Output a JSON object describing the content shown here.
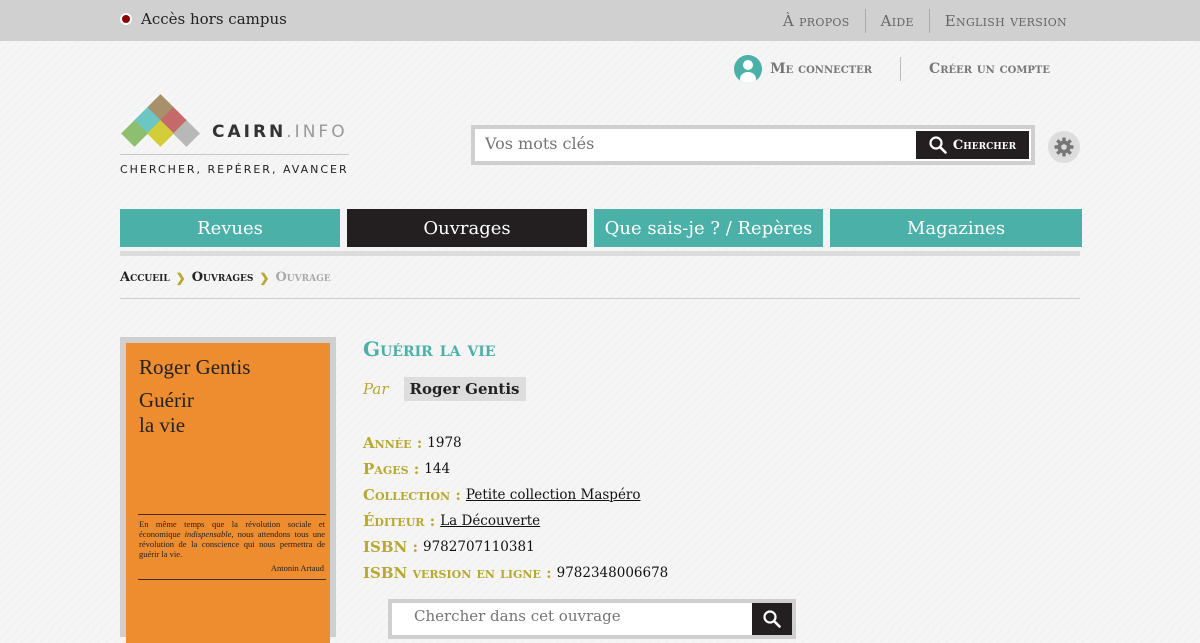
{
  "topbar": {
    "campus_label": "Accès hors campus",
    "links": [
      "À propos",
      "Aide",
      "English version"
    ]
  },
  "account": {
    "login": "Me connecter",
    "signup": "Créer un compte"
  },
  "logo": {
    "word": "CAIRN",
    "suffix": ".INFO",
    "tagline": "CHERCHER, REPÉRER, AVANCER",
    "colors": [
      "#a8906a",
      "#6cc6c2",
      "#c46a6a",
      "#8dbf6e",
      "#d4cd3a",
      "#b8b8b8"
    ]
  },
  "search": {
    "placeholder": "Vos mots clés",
    "button": "Chercher",
    "settings_icon": "gear-icon"
  },
  "nav": {
    "tabs": [
      {
        "label": "Revues",
        "active": false
      },
      {
        "label": "Ouvrages",
        "active": true
      },
      {
        "label": "Que sais-je ? / Repères",
        "active": false
      },
      {
        "label": "Magazines",
        "active": false
      }
    ]
  },
  "breadcrumb": [
    "Accueil",
    "Ouvrages",
    "Ouvrage"
  ],
  "cover": {
    "author": "Roger Gentis",
    "title": "Guérir\nla vie",
    "quote_before": "En même temps que la révolution sociale et économique ",
    "quote_emph": "indispensable",
    "quote_after": ", nous attendons tous une révolution de la conscience qui nous permettra de guérir la vie.",
    "signature": "Antonin Artaud",
    "color": "#ee8c30"
  },
  "book": {
    "title": "Guérir la vie",
    "by_label": "Par",
    "author": "Roger Gentis",
    "fields": [
      {
        "key": "Année :",
        "value": "1978",
        "link": false
      },
      {
        "key": "Pages :",
        "value": "144",
        "link": false
      },
      {
        "key": "Collection :",
        "value": "Petite collection Maspéro",
        "link": true
      },
      {
        "key": "Éditeur :",
        "value": "La Découverte",
        "link": true
      },
      {
        "key": "ISBN :",
        "value": "9782707110381",
        "link": false
      },
      {
        "key": "ISBN version en ligne :",
        "value": "9782348006678",
        "link": false
      }
    ]
  },
  "inner_search": {
    "placeholder": "Chercher dans cet ouvrage"
  },
  "colors": {
    "accent": "#4ab0a8",
    "dark": "#231f20",
    "gold": "#b7a832"
  }
}
